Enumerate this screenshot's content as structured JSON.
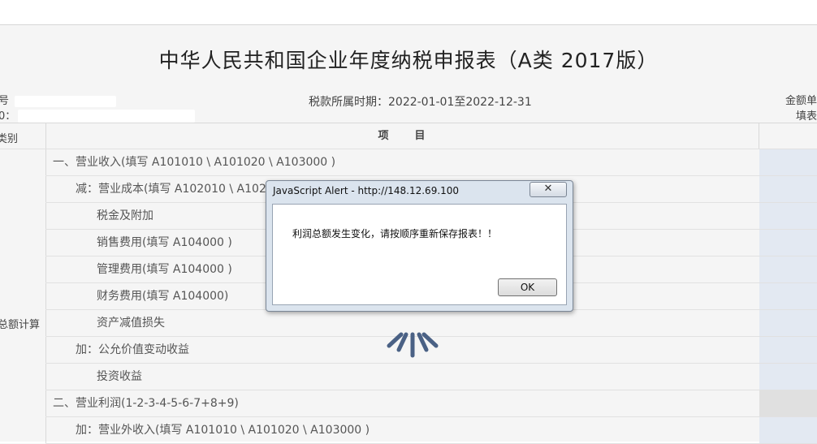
{
  "form": {
    "title": "中华人民共和国企业年度纳税申报表（A类 2017版）",
    "left_meta_line1": "号",
    "left_meta_line2": "0：",
    "period": "税款所属时期：2022-01-01至2022-12-31",
    "right_meta_line1": "金额单",
    "right_meta_line2": "填表"
  },
  "table": {
    "header_category": "类别",
    "header_item": "项　　目",
    "category_label": "总额计算",
    "rows": [
      {
        "item": "一、营业收入(填写 A101010 \\ A101020 \\ A103000 )"
      },
      {
        "item": "减：营业成本(填写 A102010 \\ A1020"
      },
      {
        "item": "税金及附加"
      },
      {
        "item": "销售费用(填写 A104000 )"
      },
      {
        "item": "管理费用(填写 A104000 )"
      },
      {
        "item": "财务费用(填写 A104000)"
      },
      {
        "item": "资产减值损失"
      },
      {
        "item": "加：公允价值变动收益"
      },
      {
        "item": "投资收益"
      },
      {
        "item": "二、营业利润(1-2-3-4-5-6-7+8+9)"
      },
      {
        "item": "加：营业外收入(填写 A101010 \\ A101020 \\ A103000 )"
      }
    ]
  },
  "dialog": {
    "title": "JavaScript Alert - http://148.12.69.100",
    "close_glyph": "✕",
    "message": "利润总额发生变化，请按顺序重新保存报表！！",
    "ok_label": "OK"
  }
}
